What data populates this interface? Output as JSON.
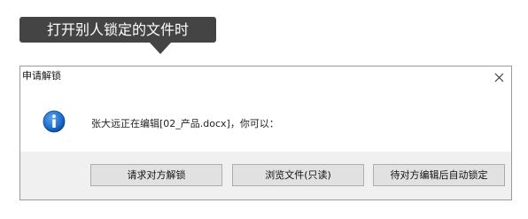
{
  "callout": {
    "text": "打开别人锁定的文件时"
  },
  "dialog": {
    "title": "申请解锁",
    "close_icon": "close-icon",
    "info_icon": "info-icon",
    "message": "张大远正在编辑[02_产品.docx]，你可以：",
    "buttons": {
      "request_unlock": "请求对方解锁",
      "browse_readonly": "浏览文件(只读)",
      "wait_lock": "待对方编辑后自动锁定"
    }
  },
  "colors": {
    "callout_bg": "#444444",
    "icon_blue": "#1e6fd0",
    "footer_bg": "#f0f0f0",
    "button_bg": "#e1e1e1"
  }
}
